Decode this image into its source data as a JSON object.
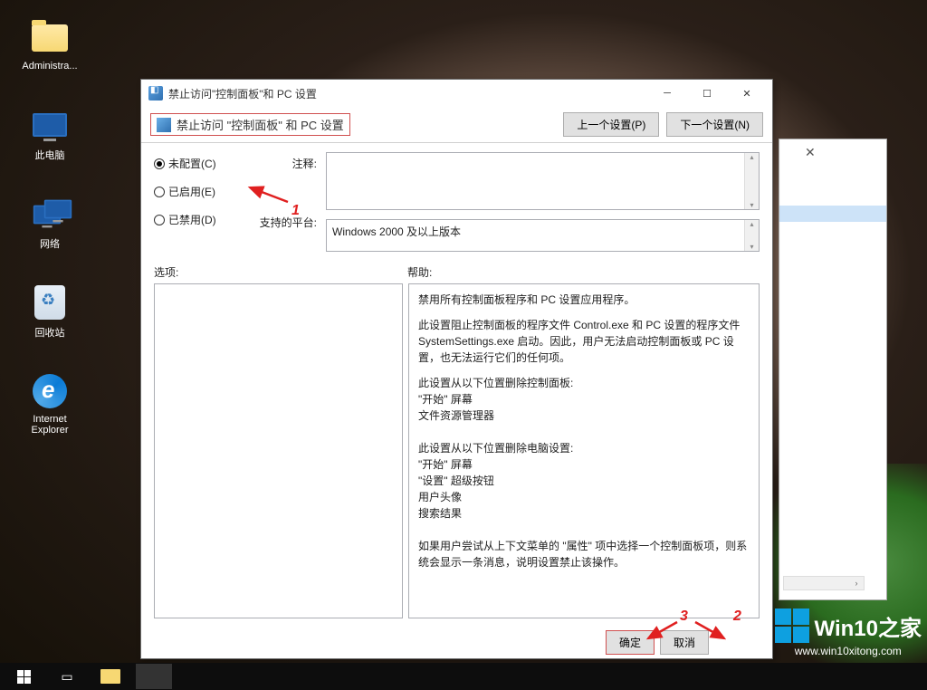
{
  "desktop": {
    "admin": "Administra...",
    "pc": "此电脑",
    "network": "网络",
    "recycle": "回收站",
    "ie1": "Internet",
    "ie2": "Explorer"
  },
  "dialog": {
    "title": "禁止访问\"控制面板\"和 PC 设置",
    "policy_name": "禁止访问 \"控制面板\" 和 PC 设置",
    "prev_btn": "上一个设置(P)",
    "next_btn": "下一个设置(N)",
    "radio_notconfig": "未配置(C)",
    "radio_enabled": "已启用(E)",
    "radio_disabled": "已禁用(D)",
    "comment_label": "注释:",
    "supported_label": "支持的平台:",
    "supported_value": "Windows 2000 及以上版本",
    "options_label": "选项:",
    "help_label": "帮助:",
    "help_p1": "禁用所有控制面板程序和 PC 设置应用程序。",
    "help_p2": "此设置阻止控制面板的程序文件 Control.exe 和 PC 设置的程序文件 SystemSettings.exe 启动。因此，用户无法启动控制面板或 PC 设置，也无法运行它们的任何项。",
    "help_p3": "此设置从以下位置删除控制面板:",
    "help_p3a": "\"开始\" 屏幕",
    "help_p3b": "文件资源管理器",
    "help_p4": "此设置从以下位置删除电脑设置:",
    "help_p4a": "\"开始\" 屏幕",
    "help_p4b": "\"设置\" 超级按钮",
    "help_p4c": "用户头像",
    "help_p4d": "搜索结果",
    "help_p5": "如果用户尝试从上下文菜单的 \"属性\" 项中选择一个控制面板项，则系统会显示一条消息，说明设置禁止该操作。",
    "ok_btn": "确定",
    "cancel_btn": "取消"
  },
  "anno": {
    "n1": "1",
    "n2": "2",
    "n3": "3"
  },
  "watermark": {
    "brand": "Win10",
    "suffix": "之家",
    "url": "www.win10xitong.com"
  }
}
